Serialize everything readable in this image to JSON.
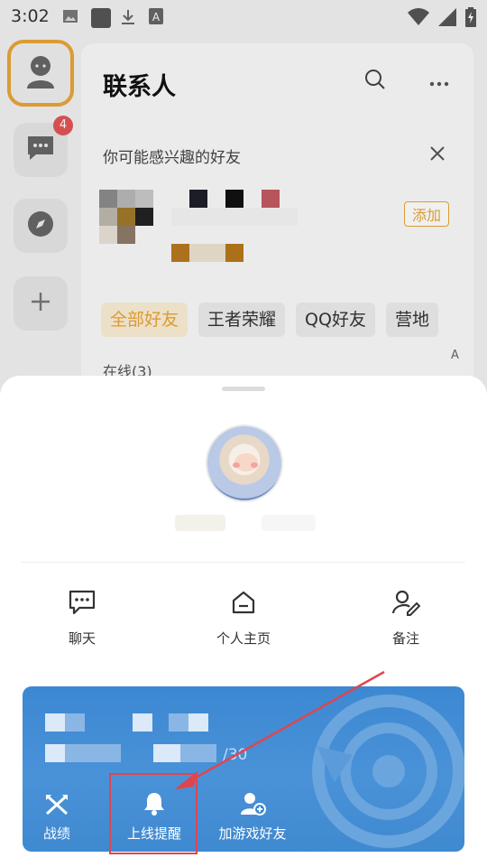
{
  "status_bar": {
    "time": "3:02"
  },
  "rail": {
    "chat_badge": "4"
  },
  "contacts_panel": {
    "title": "联系人",
    "suggest_label": "你可能感兴趣的好友",
    "add_button": "添加",
    "filters": [
      "全部好友",
      "王者荣耀",
      "QQ好友",
      "营地"
    ],
    "online_label": "在线(3)",
    "alpha_index": "A"
  },
  "sheet": {
    "actions": [
      {
        "label": "聊天",
        "icon": "chat-bubble-icon"
      },
      {
        "label": "个人主页",
        "icon": "home-icon"
      },
      {
        "label": "备注",
        "icon": "edit-user-icon"
      }
    ],
    "game_card": {
      "partial_text": "/30",
      "actions": [
        {
          "label": "战绩",
          "icon": "crossed-swords-icon"
        },
        {
          "label": "上线提醒",
          "icon": "bell-icon"
        },
        {
          "label": "加游戏好友",
          "icon": "add-friend-icon"
        }
      ]
    }
  },
  "colors": {
    "accent": "#e9a537",
    "badge": "#e25656",
    "card": "#4a92d8",
    "highlight": "#e0454f"
  }
}
